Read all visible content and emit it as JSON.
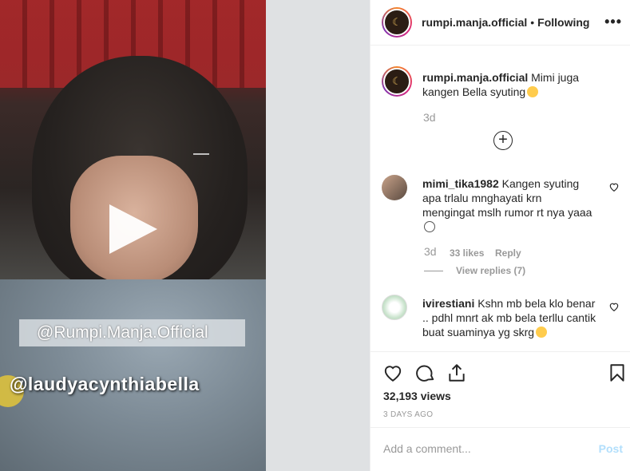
{
  "video": {
    "watermark1": "@Rumpi.Manja.Official",
    "watermark2": "@laudyacynthiabella"
  },
  "header": {
    "username": "rumpi.manja.official",
    "separator": "•",
    "follow_status": "Following",
    "more": "•••"
  },
  "caption": {
    "username": "rumpi.manja.official",
    "text": "Mimi juga kangen Bella syuting",
    "time": "3d"
  },
  "comments": [
    {
      "username": "mimi_tika1982",
      "text": "Kangen syuting apa trlalu mnghayati krn mengingat mslh rumor rt nya yaaa",
      "time": "3d",
      "likes": "33 likes",
      "reply": "Reply",
      "view_replies": "View replies (7)"
    },
    {
      "username": "ivirestiani",
      "text": "Kshn mb bela klo benar .. pdhl mnrt ak mb bela terllu cantik buat suaminya yg skrg"
    }
  ],
  "stats": {
    "views": "32,193 views",
    "posted": "3 DAYS AGO"
  },
  "add_comment": {
    "placeholder": "Add a comment...",
    "post": "Post"
  },
  "colors": {
    "link_disabled": "#b2dffc",
    "muted": "#999999",
    "text": "#262626"
  }
}
